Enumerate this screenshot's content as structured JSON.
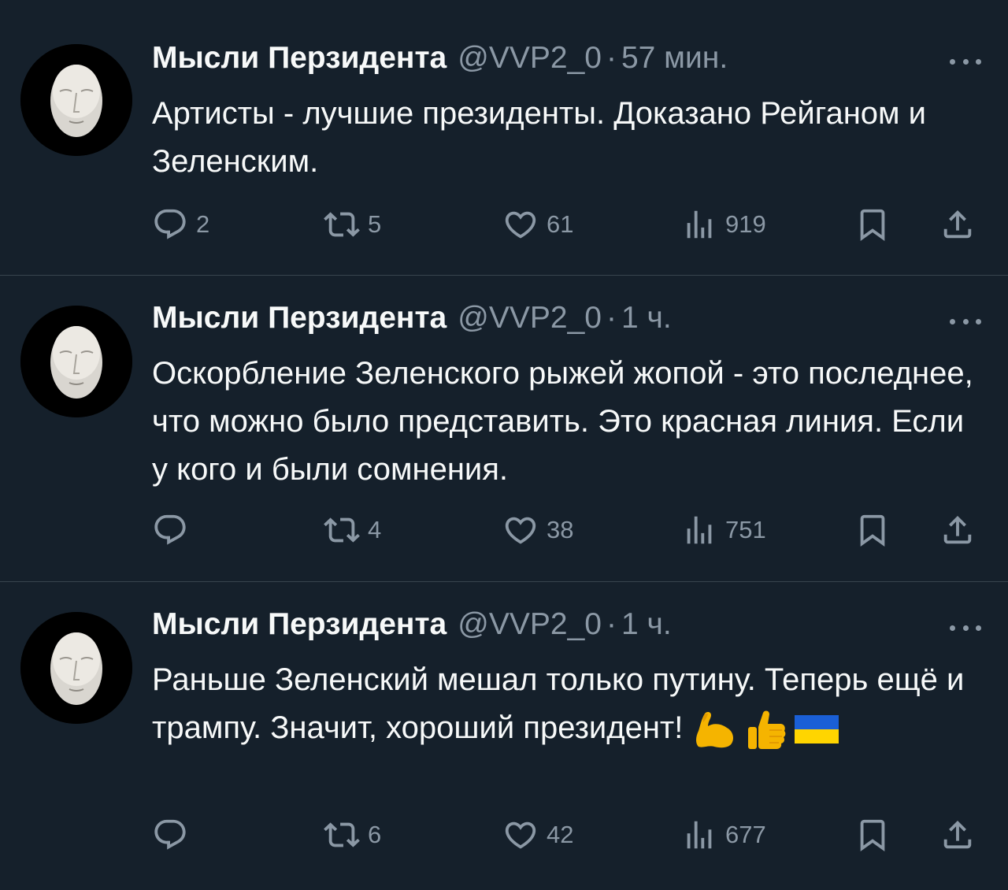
{
  "tweets": [
    {
      "author": {
        "display_name": "Мысли Перзидента",
        "handle": "@VVP2_0"
      },
      "separator": "·",
      "time": "57 мин.",
      "text": "Артисты - лучшие президенты. Доказано Рейганом и Зеленским.",
      "emojis": [],
      "stats": {
        "replies": "2",
        "retweets": "5",
        "likes": "61",
        "views": "919"
      }
    },
    {
      "author": {
        "display_name": "Мысли Перзидента",
        "handle": "@VVP2_0"
      },
      "separator": "·",
      "time": "1 ч.",
      "text": "Оскорбление Зеленского рыжей жопой - это последнее, что можно было представить. Это красная линия. Если у кого и были сомнения.",
      "emojis": [],
      "stats": {
        "replies": "",
        "retweets": "4",
        "likes": "38",
        "views": "751"
      }
    },
    {
      "author": {
        "display_name": "Мысли Перзидента",
        "handle": "@VVP2_0"
      },
      "separator": "·",
      "time": "1 ч.",
      "text": "Раньше Зеленский мешал только путину. Теперь ещё и трампу. Значит, хороший президент!",
      "emojis": [
        "flexed-biceps",
        "thumbs-up",
        "flag-ukraine"
      ],
      "stats": {
        "replies": "",
        "retweets": "6",
        "likes": "42",
        "views": "677"
      }
    }
  ],
  "icons": {
    "reply": "reply-icon",
    "retweet": "retweet-icon",
    "like": "heart-icon",
    "views": "views-icon",
    "bookmark": "bookmark-icon",
    "share": "share-icon",
    "more": "more-icon"
  },
  "colors": {
    "background": "#15202b",
    "divider": "#38444d",
    "text_primary": "#f7f9f9",
    "text_secondary": "#8b98a5"
  }
}
